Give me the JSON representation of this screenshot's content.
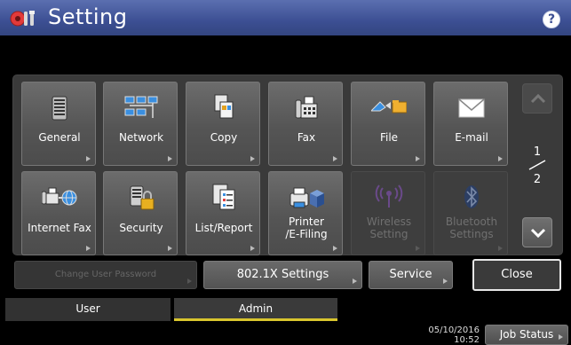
{
  "header": {
    "title": "Setting",
    "help_label": "?"
  },
  "tiles": {
    "general": "General",
    "network": "Network",
    "copy": "Copy",
    "fax": "Fax",
    "file": "File",
    "email": "E-mail",
    "internet_fax": "Internet Fax",
    "security": "Security",
    "list_report": "List/Report",
    "printer_line1": "Printer",
    "printer_line2": "/E-Filing",
    "wireless_line1": "Wireless",
    "wireless_line2": "Setting",
    "bluetooth_line1": "Bluetooth",
    "bluetooth_line2": "Settings"
  },
  "pager": {
    "current": "1",
    "total": "2"
  },
  "bottom_buttons": {
    "change_password": "Change User Password",
    "dot1x": "802.1X Settings",
    "service": "Service",
    "close": "Close"
  },
  "tabs": {
    "user": "User",
    "admin": "Admin"
  },
  "status": {
    "date": "05/10/2016",
    "time": "10:52",
    "job_status": "Job Status"
  },
  "colors": {
    "title_bar": "#3c4f93",
    "active_tab_underline": "#d8c52e",
    "panel": "#3a3a3a"
  },
  "icons": [
    "gear-wrench-icon",
    "help-icon",
    "general-icon",
    "network-icon",
    "copy-icon",
    "fax-icon",
    "file-icon",
    "email-icon",
    "internet-fax-icon",
    "security-icon",
    "list-report-icon",
    "printer-efiling-icon",
    "wireless-icon",
    "bluetooth-icon",
    "chevron-up-icon",
    "chevron-down-icon"
  ]
}
